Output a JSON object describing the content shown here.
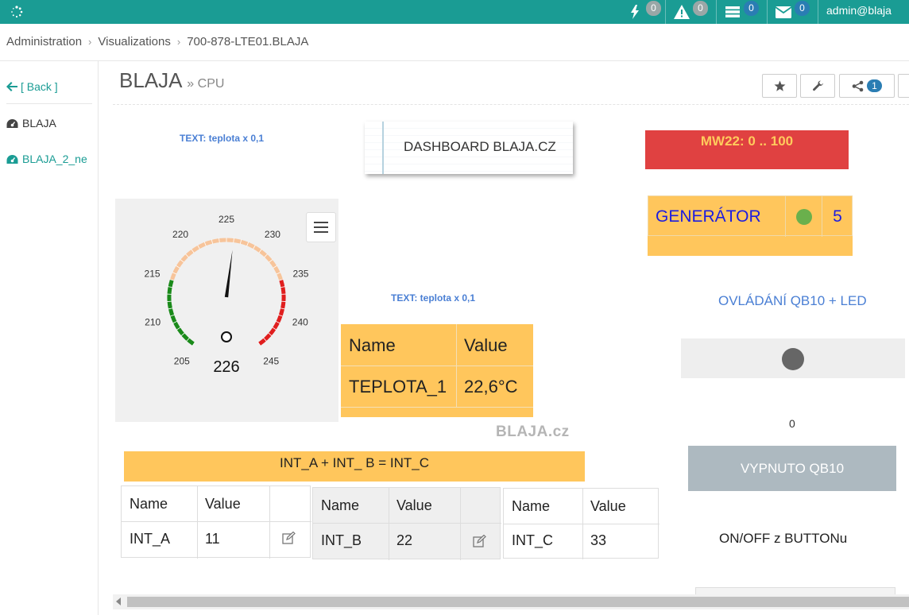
{
  "topbar": {
    "badges": {
      "events": "0",
      "alerts": "0",
      "queue": "0",
      "messages": "0"
    },
    "user": "admin@blaja"
  },
  "breadcrumb": [
    "Administration",
    "Visualizations",
    "700-878-LTE01.BLAJA"
  ],
  "sidebar": {
    "back": "[ Back ]",
    "items": [
      "BLAJA",
      "BLAJA_2_ne"
    ]
  },
  "page": {
    "title": "BLAJA",
    "subtitle": "» CPU"
  },
  "header_buttons": {
    "share_count": "1"
  },
  "widgets": {
    "text_label_1": "TEXT: teplota x 0,1",
    "text_label_2": "TEXT: teplota x 0,1",
    "dashboard_note": "DASHBOARD BLAJA.CZ",
    "mw22": "MW22: 0 .. 100",
    "generator": {
      "label": "GENERÁTOR",
      "value": "5",
      "led_color": "#6ab04c"
    },
    "gauge": {
      "value": 226,
      "min": 205,
      "max": 245,
      "ticks": [
        "205",
        "210",
        "215",
        "220",
        "225",
        "230",
        "235",
        "240",
        "245"
      ],
      "bands": [
        {
          "from": 205,
          "to": 215,
          "color": "#1a8a1a"
        },
        {
          "from": 215,
          "to": 235,
          "color": "#f7c49a"
        },
        {
          "from": 235,
          "to": 245,
          "color": "#e01e1e"
        }
      ]
    },
    "teplota_table": {
      "headers": [
        "Name",
        "Value"
      ],
      "rows": [
        [
          "TEPLOTA_1",
          "22,6°C"
        ]
      ]
    },
    "watermark": "BLAJA.cz",
    "control_title": "OVLÁDÁNÍ QB10 + LED",
    "led_value": "0",
    "toggle_button": "VYPNUTO QB10",
    "onoff_label": "ON/OFF z BUTTONu",
    "int_formula": "INT_A  + INT_ B  = INT_C",
    "int_tables": [
      {
        "headers": [
          "Name",
          "Value"
        ],
        "row": [
          "INT_A",
          "11"
        ]
      },
      {
        "headers": [
          "Name",
          "Value"
        ],
        "row": [
          "INT_B",
          "22"
        ]
      },
      {
        "headers": [
          "Name",
          "Value"
        ],
        "row": [
          "INT_C",
          "33"
        ]
      }
    ]
  },
  "colors": {
    "teal": "#1a9c94",
    "amber": "#ffc65c",
    "red": "#e04141",
    "blue_text": "#4a7fd4"
  }
}
